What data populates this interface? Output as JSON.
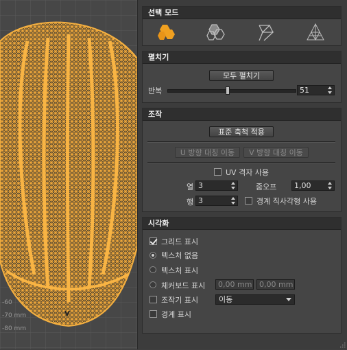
{
  "viewport": {
    "axis_labels": [
      "-60",
      "-70 mm",
      "-80 mm"
    ],
    "pin_label": "V"
  },
  "selection_mode": {
    "title": "선택 모드",
    "modes": [
      "polygon-select-icon",
      "edge-select-icon",
      "vertex-select-icon",
      "mesh-select-icon"
    ],
    "active_color": "#f0a020"
  },
  "unfold": {
    "title": "펼치기",
    "unfold_all_label": "모두 펼치기",
    "iterations_label": "반복",
    "iterations_value": "51",
    "iterations_fraction": 0.47
  },
  "manipulate": {
    "title": "조작",
    "apply_scale_label": "표준 축척 적용",
    "mirror_u_label": "U 방향 대칭 이동",
    "mirror_v_label": "V 방향 대칭 이동",
    "uv_grid_label": "UV 격자 사용",
    "columns_label": "열",
    "columns_value": "3",
    "rows_label": "행",
    "rows_value": "3",
    "zoom_label": "줌오프",
    "zoom_value": "1,00",
    "boundary_rect_label": "경계 직사각형 사용"
  },
  "visualize": {
    "title": "시각화",
    "show_grid_label": "그리드 표시",
    "no_texture_label": "텍스처 없음",
    "show_texture_label": "텍스처 표시",
    "checkerboard_label": "체커보드 표시",
    "checker_u_value": "0,00 mm",
    "checker_v_value": "0,00 mm",
    "show_manipulator_label": "조작기 표시",
    "manipulator_mode_value": "이동",
    "show_boundary_label": "경계 표시"
  }
}
